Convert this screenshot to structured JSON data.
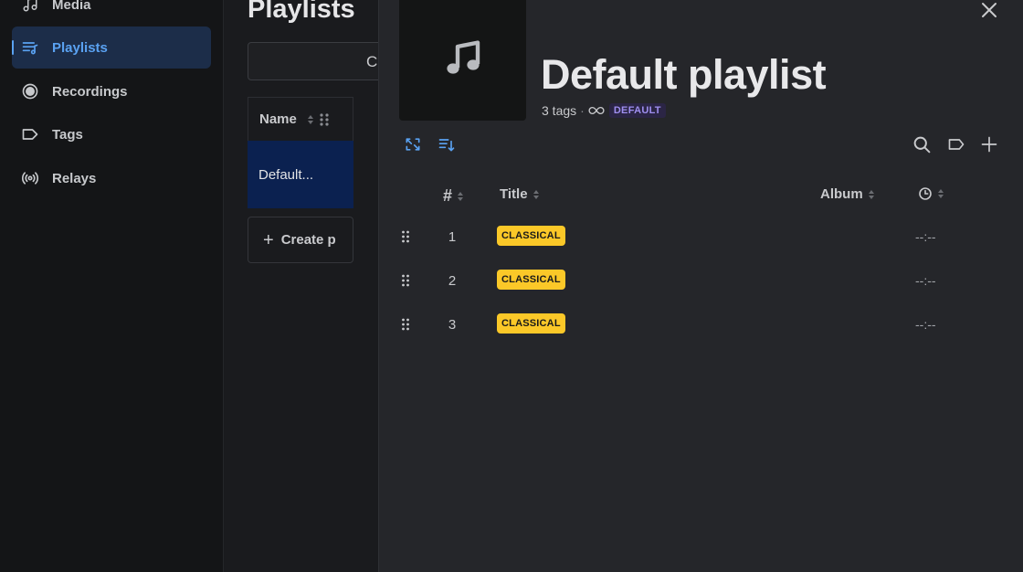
{
  "sidebar": {
    "items": [
      {
        "label": "Media",
        "icon": "music-note-icon"
      },
      {
        "label": "Playlists",
        "icon": "playlist-icon",
        "active": true
      },
      {
        "label": "Recordings",
        "icon": "record-icon"
      },
      {
        "label": "Tags",
        "icon": "tag-icon"
      },
      {
        "label": "Relays",
        "icon": "broadcast-icon"
      }
    ]
  },
  "list": {
    "title": "Playlists",
    "search_partial_glyph": "C",
    "column_name": "Name",
    "row_label": "Default...",
    "create_label": "Create p"
  },
  "detail": {
    "title": "Default playlist",
    "tag_count": "3 tags",
    "separator": "·",
    "default_badge": "DEFAULT",
    "columns": {
      "number": "#",
      "title": "Title",
      "album": "Album"
    },
    "rows": [
      {
        "number": "1",
        "tag": "CLASSICAL",
        "duration": "--:--"
      },
      {
        "number": "2",
        "tag": "CLASSICAL",
        "duration": "--:--"
      },
      {
        "number": "3",
        "tag": "CLASSICAL",
        "duration": "--:--"
      }
    ]
  },
  "colors": {
    "accent": "#5aa2f2",
    "tag_bg": "#fbc828",
    "default_badge": "#9f8ff0",
    "selected_row": "#0b2150"
  }
}
